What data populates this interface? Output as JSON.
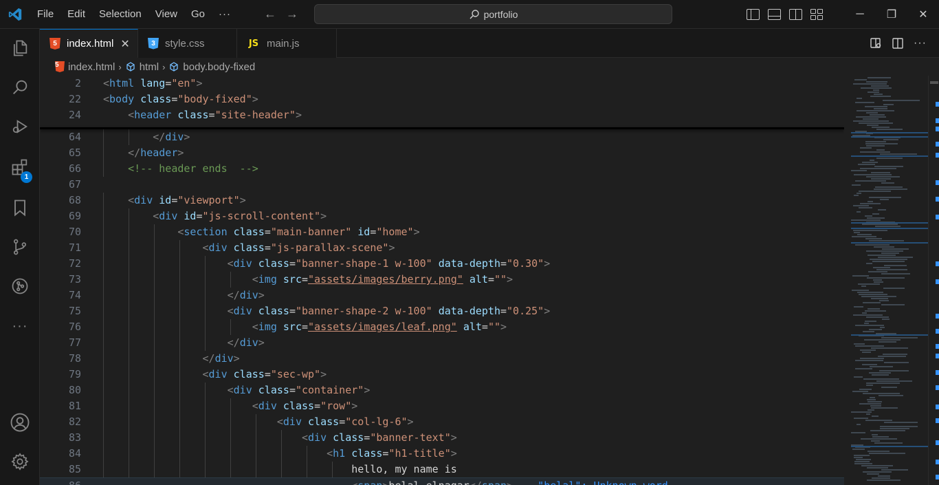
{
  "menu": [
    "File",
    "Edit",
    "Selection",
    "View",
    "Go",
    "···"
  ],
  "search": {
    "text": "portfolio"
  },
  "window": {
    "minimize": "─",
    "restore": "❐",
    "close": "✕"
  },
  "activity": {
    "extensions_badge": "1"
  },
  "tabs": [
    {
      "icon": "html5-icon",
      "label": "index.html",
      "active": true,
      "close": "✕"
    },
    {
      "icon": "css3-icon",
      "label": "style.css"
    },
    {
      "icon": "js-icon",
      "icon_text": "JS",
      "label": "main.js"
    }
  ],
  "breadcrumb": {
    "file": "index.html",
    "seg1": "html",
    "seg2": "body.body-fixed",
    "sep": "›"
  },
  "file_icon_text": {
    "html": "5",
    "css": "3"
  },
  "editor": {
    "sticky": [
      {
        "n": "2",
        "tokens": [
          [
            "p",
            "<"
          ],
          [
            "t",
            "html"
          ],
          [
            "txt",
            " "
          ],
          [
            "a",
            "lang"
          ],
          [
            "txt",
            "="
          ],
          [
            "s",
            "\"en\""
          ],
          [
            "p",
            ">"
          ]
        ]
      },
      {
        "n": "22",
        "tokens": [
          [
            "p",
            "<"
          ],
          [
            "t",
            "body"
          ],
          [
            "txt",
            " "
          ],
          [
            "a",
            "class"
          ],
          [
            "txt",
            "="
          ],
          [
            "s",
            "\"body-fixed\""
          ],
          [
            "p",
            ">"
          ]
        ]
      },
      {
        "n": "24",
        "tokens": [
          [
            "txt",
            "    "
          ],
          [
            "p",
            "<"
          ],
          [
            "t",
            "header"
          ],
          [
            "txt",
            " "
          ],
          [
            "a",
            "class"
          ],
          [
            "txt",
            "="
          ],
          [
            "s",
            "\"site-header\""
          ],
          [
            "p",
            ">"
          ]
        ]
      }
    ],
    "lines": [
      {
        "n": "64",
        "tokens": [
          [
            "txt",
            "        "
          ],
          [
            "p",
            "</"
          ],
          [
            "t",
            "div"
          ],
          [
            "p",
            ">"
          ]
        ]
      },
      {
        "n": "65",
        "tokens": [
          [
            "txt",
            "    "
          ],
          [
            "p",
            "</"
          ],
          [
            "t",
            "header"
          ],
          [
            "p",
            ">"
          ]
        ]
      },
      {
        "n": "66",
        "tokens": [
          [
            "txt",
            "    "
          ],
          [
            "c",
            "<!-- header ends  -->"
          ]
        ]
      },
      {
        "n": "67",
        "tokens": []
      },
      {
        "n": "68",
        "tokens": [
          [
            "txt",
            "    "
          ],
          [
            "p",
            "<"
          ],
          [
            "t",
            "div"
          ],
          [
            "txt",
            " "
          ],
          [
            "a",
            "id"
          ],
          [
            "txt",
            "="
          ],
          [
            "s",
            "\"viewport\""
          ],
          [
            "p",
            ">"
          ]
        ]
      },
      {
        "n": "69",
        "tokens": [
          [
            "txt",
            "        "
          ],
          [
            "p",
            "<"
          ],
          [
            "t",
            "div"
          ],
          [
            "txt",
            " "
          ],
          [
            "a",
            "id"
          ],
          [
            "txt",
            "="
          ],
          [
            "s",
            "\"js-scroll-content\""
          ],
          [
            "p",
            ">"
          ]
        ]
      },
      {
        "n": "70",
        "tokens": [
          [
            "txt",
            "            "
          ],
          [
            "p",
            "<"
          ],
          [
            "t",
            "section"
          ],
          [
            "txt",
            " "
          ],
          [
            "a",
            "class"
          ],
          [
            "txt",
            "="
          ],
          [
            "s",
            "\"main-banner\""
          ],
          [
            "txt",
            " "
          ],
          [
            "a",
            "id"
          ],
          [
            "txt",
            "="
          ],
          [
            "s",
            "\"home\""
          ],
          [
            "p",
            ">"
          ]
        ]
      },
      {
        "n": "71",
        "tokens": [
          [
            "txt",
            "                "
          ],
          [
            "p",
            "<"
          ],
          [
            "t",
            "div"
          ],
          [
            "txt",
            " "
          ],
          [
            "a",
            "class"
          ],
          [
            "txt",
            "="
          ],
          [
            "s",
            "\"js-parallax-scene\""
          ],
          [
            "p",
            ">"
          ]
        ]
      },
      {
        "n": "72",
        "tokens": [
          [
            "txt",
            "                    "
          ],
          [
            "p",
            "<"
          ],
          [
            "t",
            "div"
          ],
          [
            "txt",
            " "
          ],
          [
            "a",
            "class"
          ],
          [
            "txt",
            "="
          ],
          [
            "s",
            "\"banner-shape-1 w-100\""
          ],
          [
            "txt",
            " "
          ],
          [
            "a",
            "data-depth"
          ],
          [
            "txt",
            "="
          ],
          [
            "s",
            "\"0.30\""
          ],
          [
            "p",
            ">"
          ]
        ]
      },
      {
        "n": "73",
        "tokens": [
          [
            "txt",
            "                        "
          ],
          [
            "p",
            "<"
          ],
          [
            "t",
            "img"
          ],
          [
            "txt",
            " "
          ],
          [
            "a",
            "src"
          ],
          [
            "txt",
            "="
          ],
          [
            "su",
            "\"assets/images/berry.png\""
          ],
          [
            "txt",
            " "
          ],
          [
            "a",
            "alt"
          ],
          [
            "txt",
            "="
          ],
          [
            "s",
            "\"\""
          ],
          [
            "p",
            ">"
          ]
        ]
      },
      {
        "n": "74",
        "tokens": [
          [
            "txt",
            "                    "
          ],
          [
            "p",
            "</"
          ],
          [
            "t",
            "div"
          ],
          [
            "p",
            ">"
          ]
        ]
      },
      {
        "n": "75",
        "tokens": [
          [
            "txt",
            "                    "
          ],
          [
            "p",
            "<"
          ],
          [
            "t",
            "div"
          ],
          [
            "txt",
            " "
          ],
          [
            "a",
            "class"
          ],
          [
            "txt",
            "="
          ],
          [
            "s",
            "\"banner-shape-2 w-100\""
          ],
          [
            "txt",
            " "
          ],
          [
            "a",
            "data-depth"
          ],
          [
            "txt",
            "="
          ],
          [
            "s",
            "\"0.25\""
          ],
          [
            "p",
            ">"
          ]
        ]
      },
      {
        "n": "76",
        "tokens": [
          [
            "txt",
            "                        "
          ],
          [
            "p",
            "<"
          ],
          [
            "t",
            "img"
          ],
          [
            "txt",
            " "
          ],
          [
            "a",
            "src"
          ],
          [
            "txt",
            "="
          ],
          [
            "su",
            "\"assets/images/leaf.png\""
          ],
          [
            "txt",
            " "
          ],
          [
            "a",
            "alt"
          ],
          [
            "txt",
            "="
          ],
          [
            "s",
            "\"\""
          ],
          [
            "p",
            ">"
          ]
        ]
      },
      {
        "n": "77",
        "tokens": [
          [
            "txt",
            "                    "
          ],
          [
            "p",
            "</"
          ],
          [
            "t",
            "div"
          ],
          [
            "p",
            ">"
          ]
        ]
      },
      {
        "n": "78",
        "tokens": [
          [
            "txt",
            "                "
          ],
          [
            "p",
            "</"
          ],
          [
            "t",
            "div"
          ],
          [
            "p",
            ">"
          ]
        ]
      },
      {
        "n": "79",
        "tokens": [
          [
            "txt",
            "                "
          ],
          [
            "p",
            "<"
          ],
          [
            "t",
            "div"
          ],
          [
            "txt",
            " "
          ],
          [
            "a",
            "class"
          ],
          [
            "txt",
            "="
          ],
          [
            "s",
            "\"sec-wp\""
          ],
          [
            "p",
            ">"
          ]
        ]
      },
      {
        "n": "80",
        "tokens": [
          [
            "txt",
            "                    "
          ],
          [
            "p",
            "<"
          ],
          [
            "t",
            "div"
          ],
          [
            "txt",
            " "
          ],
          [
            "a",
            "class"
          ],
          [
            "txt",
            "="
          ],
          [
            "s",
            "\"container\""
          ],
          [
            "p",
            ">"
          ]
        ]
      },
      {
        "n": "81",
        "tokens": [
          [
            "txt",
            "                        "
          ],
          [
            "p",
            "<"
          ],
          [
            "t",
            "div"
          ],
          [
            "txt",
            " "
          ],
          [
            "a",
            "class"
          ],
          [
            "txt",
            "="
          ],
          [
            "s",
            "\"row\""
          ],
          [
            "p",
            ">"
          ]
        ]
      },
      {
        "n": "82",
        "tokens": [
          [
            "txt",
            "                            "
          ],
          [
            "p",
            "<"
          ],
          [
            "t",
            "div"
          ],
          [
            "txt",
            " "
          ],
          [
            "a",
            "class"
          ],
          [
            "txt",
            "="
          ],
          [
            "s",
            "\"col-lg-6\""
          ],
          [
            "p",
            ">"
          ]
        ]
      },
      {
        "n": "83",
        "tokens": [
          [
            "txt",
            "                                "
          ],
          [
            "p",
            "<"
          ],
          [
            "t",
            "div"
          ],
          [
            "txt",
            " "
          ],
          [
            "a",
            "class"
          ],
          [
            "txt",
            "="
          ],
          [
            "s",
            "\"banner-text\""
          ],
          [
            "p",
            ">"
          ]
        ]
      },
      {
        "n": "84",
        "tokens": [
          [
            "txt",
            "                                    "
          ],
          [
            "p",
            "<"
          ],
          [
            "t",
            "h1"
          ],
          [
            "txt",
            " "
          ],
          [
            "a",
            "class"
          ],
          [
            "txt",
            "="
          ],
          [
            "s",
            "\"h1-title\""
          ],
          [
            "p",
            ">"
          ]
        ]
      },
      {
        "n": "85",
        "tokens": [
          [
            "txt",
            "                                        "
          ],
          [
            "txt",
            "hello, my name is"
          ]
        ]
      },
      {
        "n": "86",
        "cur": true,
        "tokens": [
          [
            "txt",
            "                                        "
          ],
          [
            "p",
            "<"
          ],
          [
            "t",
            "span"
          ],
          [
            "p",
            ">"
          ],
          [
            "txt",
            "belal elnagar"
          ],
          [
            "p",
            "</"
          ],
          [
            "t",
            "span"
          ],
          [
            "p",
            ">"
          ],
          [
            "txt",
            "    "
          ],
          [
            "diag",
            "\"belal\": Unknown word."
          ]
        ]
      }
    ]
  }
}
